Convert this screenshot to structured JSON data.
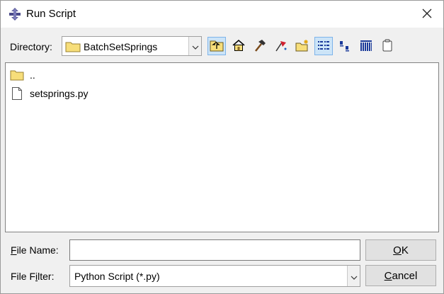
{
  "window": {
    "title": "Run Script"
  },
  "directory": {
    "label_prefix": "Directory",
    "label_suffix": ":",
    "value": "BatchSetSprings"
  },
  "toolbar": [
    "up-folder-icon",
    "home-icon",
    "hammer-icon",
    "bookmark-icon",
    "new-folder-icon",
    "list-view-icon",
    "details-view-icon",
    "detail-grid-icon",
    "clipboard-icon"
  ],
  "files": [
    {
      "name": "..",
      "type": "folder"
    },
    {
      "name": "setsprings.py",
      "type": "file"
    }
  ],
  "file_name": {
    "label_u": "F",
    "label_rest": "ile Name:",
    "value": ""
  },
  "file_filter": {
    "label_pre": "File F",
    "label_u": "i",
    "label_post": "lter:",
    "value": "Python Script (*.py)"
  },
  "buttons": {
    "ok_u": "O",
    "ok_rest": "K",
    "cancel_u": "C",
    "cancel_rest": "ancel"
  }
}
